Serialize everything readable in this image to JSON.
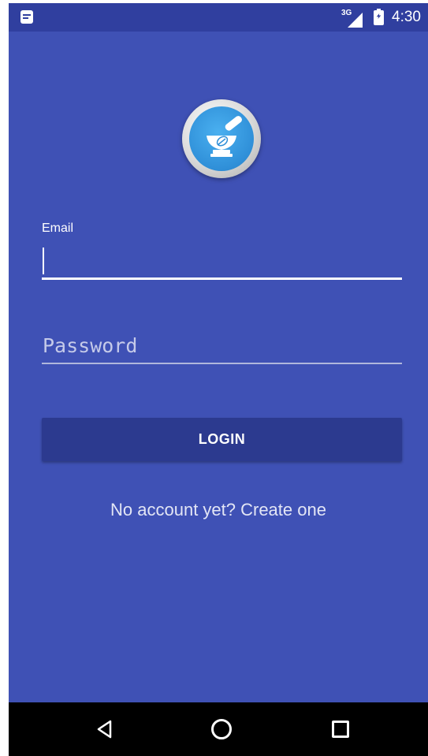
{
  "status_bar": {
    "network_type": "3G",
    "time": "4:30",
    "icons": [
      "notification-icon",
      "signal-icon",
      "battery-charging-icon"
    ]
  },
  "logo": {
    "icon": "mortar-pestle-leaf-icon"
  },
  "email": {
    "label": "Email",
    "value": ""
  },
  "password": {
    "placeholder": "Password",
    "value": ""
  },
  "login_button": {
    "label": "LOGIN"
  },
  "signup_link": {
    "label": "No account yet? Create one"
  },
  "nav_bar": {
    "icons": [
      "back-icon",
      "home-icon",
      "recents-icon"
    ]
  },
  "colors": {
    "primary": "#3f51b5",
    "primary_dark": "#303f9f",
    "button": "#2c3a8f",
    "logo_blue": "#2f8fd8"
  }
}
